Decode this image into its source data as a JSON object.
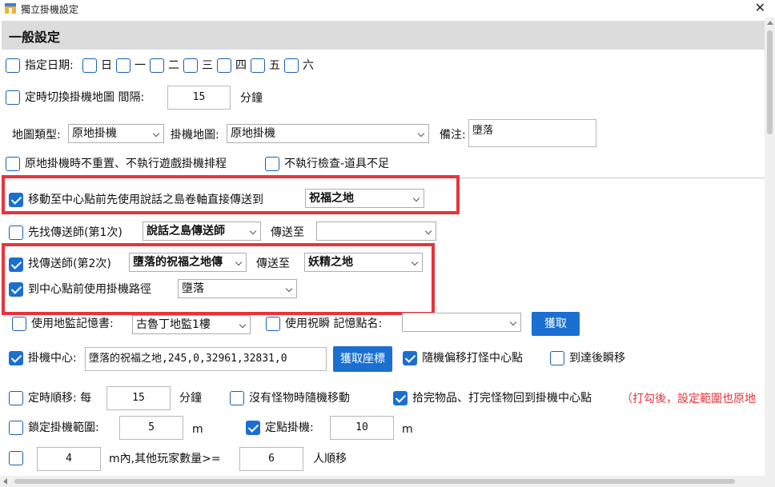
{
  "window": {
    "title": "獨立掛機設定",
    "close_glyph": "✕"
  },
  "section": {
    "title": "一般設定"
  },
  "row1": {
    "label": "指定日期:",
    "days": [
      "日",
      "一",
      "二",
      "三",
      "四",
      "五",
      "六"
    ]
  },
  "row2": {
    "label": "定時切換掛機地圖 間隔:",
    "value": "15",
    "unit": "分鐘"
  },
  "row3": {
    "map_type_label": "地圖類型:",
    "map_type_value": "原地掛機",
    "map_label": "掛機地圖:",
    "map_value": "原地掛機",
    "note_label": "備注:",
    "note_value": "墮落"
  },
  "row4": {
    "opt1": "原地掛機時不重置、不執行遊戲掛機排程",
    "opt2": "不執行檢查-道具不足"
  },
  "row5": {
    "label": "移動至中心點前先使用說話之島卷軸直接傳送到",
    "value": "祝福之地"
  },
  "row6": {
    "label": "先找傳送師(第1次)",
    "select_value": "說話之島傳送師",
    "dest_label": "傳送至",
    "dest_value": ""
  },
  "row7": {
    "label": "找傳送師(第2次)",
    "select_value": "墮落的祝福之地傳",
    "dest_label": "傳送至",
    "dest_value": "妖精之地"
  },
  "row8": {
    "label": "到中心點前使用掛機路徑",
    "value": "墮落"
  },
  "row9": {
    "label": "使用地監記憶書:",
    "value": "古魯丁地監1樓",
    "label2": "使用祝瞬 記憶點名:",
    "value2": "",
    "button": "獲取"
  },
  "row10": {
    "label": "掛機中心:",
    "value": "墮落的祝福之地,245,0,32961,32831,0",
    "button": "獲取座標",
    "opt1": "隨機偏移打怪中心點",
    "opt2": "到達後瞬移"
  },
  "row11": {
    "label": "定時順移: 每",
    "value": "15",
    "unit": "分鐘",
    "opt1": "沒有怪物時隨機移動",
    "opt2": "拾完物品、打完怪物回到掛機中心點",
    "note": "（打勾後，設定範圍也原地"
  },
  "row12": {
    "label": "鎖定掛機範圍:",
    "value": "5",
    "unit": "m",
    "label2": "定點掛機:",
    "value2": "10",
    "unit2": "m"
  },
  "row13": {
    "value": "4",
    "middle": "m內,其他玩家數量>=",
    "value2": "6",
    "tail": "人順移"
  },
  "colors": {
    "accent": "#1a6fd1",
    "highlight": "#e8333a",
    "header_bg": "#dcdcdc"
  }
}
